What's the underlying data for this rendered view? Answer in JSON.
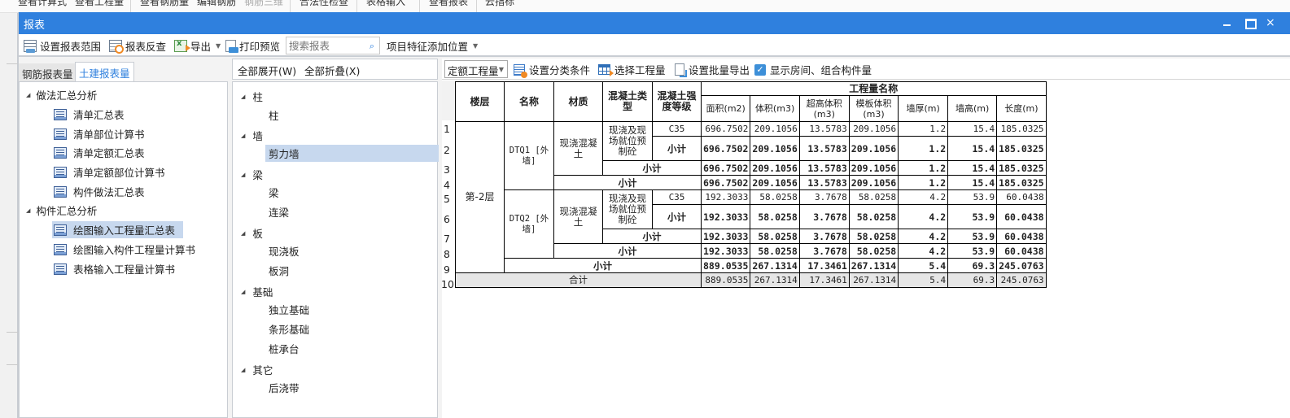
{
  "app_menu": [
    "查看计算式",
    "查看工程量",
    "查看钢筋量",
    "编辑钢筋",
    "钢筋三维",
    "合法性检查",
    "表格输入",
    "查看报表",
    "云指标"
  ],
  "dialog": {
    "title": "报表",
    "window_controls": {
      "minimize": "minimize-icon",
      "maximize": "maximize-icon",
      "close": "×"
    }
  },
  "toolbar": {
    "set_range": "设置报表范围",
    "reverse_check": "报表反查",
    "export": "导出",
    "print_preview": "打印预览",
    "search_placeholder": "搜索报表",
    "feature_position": "项目特征添加位置"
  },
  "left_panel": {
    "tabs": [
      {
        "label": "钢筋报表量",
        "active": false
      },
      {
        "label": "土建报表量",
        "active": true
      }
    ],
    "groups": [
      {
        "label": "做法汇总分析",
        "items": [
          "清单汇总表",
          "清单部位计算书",
          "清单定额汇总表",
          "清单定额部位计算书",
          "构件做法汇总表"
        ]
      },
      {
        "label": "构件汇总分析",
        "items": [
          "绘图输入工程量汇总表",
          "绘图输入构件工程量计算书",
          "表格输入工程量计算书"
        ]
      }
    ],
    "selected_item": "绘图输入工程量汇总表"
  },
  "middle_panel": {
    "expand_all": "全部展开(W)",
    "collapse_all": "全部折叠(X)",
    "groups": [
      {
        "label": "柱",
        "items": [
          "柱"
        ]
      },
      {
        "label": "墙",
        "items": [
          "剪力墙"
        ]
      },
      {
        "label": "梁",
        "items": [
          "梁",
          "连梁"
        ]
      },
      {
        "label": "板",
        "items": [
          "现浇板",
          "板洞"
        ]
      },
      {
        "label": "基础",
        "items": [
          "独立基础",
          "条形基础",
          "桩承台"
        ]
      },
      {
        "label": "其它",
        "items": [
          "后浇带"
        ]
      }
    ],
    "selected_item": "剪力墙"
  },
  "right_panel": {
    "quantity_type": "定额工程量",
    "set_category": "设置分类条件",
    "select_quantity": "选择工程量",
    "batch_export": "设置批量导出",
    "show_rooms_label": "显示房间、组合构件量",
    "show_rooms_checked": true
  },
  "report": {
    "headers": {
      "floor": "楼层",
      "name": "名称",
      "material": "材质",
      "concrete_type": "混凝土类型",
      "strength": "混凝土强度等级",
      "group": "工程量名称",
      "columns": [
        "面积(m2)",
        "体积(m3)",
        "超高体积(m3)",
        "模板体积(m3)",
        "墙厚(m)",
        "墙高(m)",
        "长度(m)"
      ]
    },
    "row_numbers": [
      "1",
      "2",
      "3",
      "4",
      "5",
      "6",
      "7",
      "8",
      "9",
      "10"
    ],
    "floor": "第-2层",
    "components": [
      {
        "name": "DTQ1 [外墙]",
        "material": "现浇混凝土",
        "concrete_type": "现浇及现场就位预制砼",
        "strength": "C35",
        "detail": [
          "696.7502",
          "209.1056",
          "13.5783",
          "209.1056",
          "1.2",
          "15.4",
          "185.0325"
        ],
        "type_subtotal": [
          "696.7502",
          "209.1056",
          "13.5783",
          "209.1056",
          "1.2",
          "15.4",
          "185.0325"
        ],
        "material_subtotal": [
          "696.7502",
          "209.1056",
          "13.5783",
          "209.1056",
          "1.2",
          "15.4",
          "185.0325"
        ],
        "name_subtotal": [
          "696.7502",
          "209.1056",
          "13.5783",
          "209.1056",
          "1.2",
          "15.4",
          "185.0325"
        ]
      },
      {
        "name": "DTQ2 [外墙]",
        "material": "现浇混凝土",
        "concrete_type": "现浇及现场就位预制砼",
        "strength": "C35",
        "detail": [
          "192.3033",
          "58.0258",
          "3.7678",
          "58.0258",
          "4.2",
          "53.9",
          "60.0438"
        ],
        "type_subtotal": [
          "192.3033",
          "58.0258",
          "3.7678",
          "58.0258",
          "4.2",
          "53.9",
          "60.0438"
        ],
        "material_subtotal": [
          "192.3033",
          "58.0258",
          "3.7678",
          "58.0258",
          "4.2",
          "53.9",
          "60.0438"
        ],
        "name_subtotal": [
          "192.3033",
          "58.0258",
          "3.7678",
          "58.0258",
          "4.2",
          "53.9",
          "60.0438"
        ]
      }
    ],
    "subtotal_label": "小计",
    "floor_subtotal": [
      "889.0535",
      "267.1314",
      "17.3461",
      "267.1314",
      "5.4",
      "69.3",
      "245.0763"
    ],
    "total_label": "合计",
    "total": [
      "889.0535",
      "267.1314",
      "17.3461",
      "267.1314",
      "5.4",
      "69.3",
      "245.0763"
    ]
  }
}
